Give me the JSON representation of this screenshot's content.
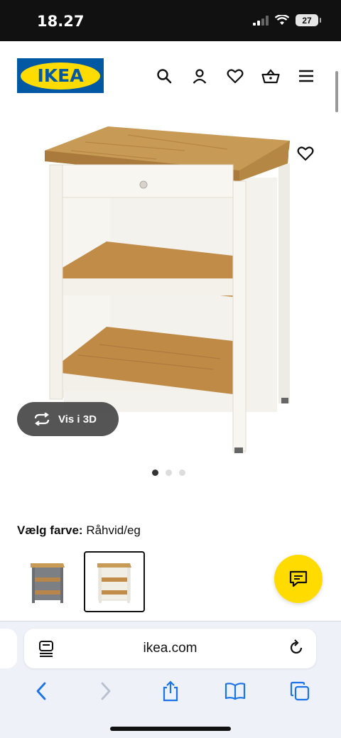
{
  "status": {
    "time": "18.27",
    "battery": "27"
  },
  "header": {
    "logo_text": "IKEA",
    "icons": [
      "search-icon",
      "user-icon",
      "heart-icon",
      "basket-icon",
      "menu-icon"
    ]
  },
  "product": {
    "view3d_label": "Vis i 3D",
    "image_count": 3,
    "active_image": 1
  },
  "color": {
    "label": "Vælg farve:",
    "value": "Råhvid/eg"
  },
  "browser": {
    "url": "ikea.com"
  },
  "colors": {
    "ikea_blue": "#0058a3",
    "ikea_yellow": "#ffdb00",
    "browser_blue": "#1a73e8"
  }
}
